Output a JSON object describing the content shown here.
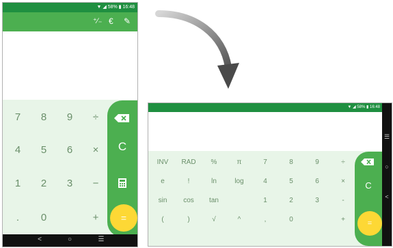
{
  "status": {
    "battery": "58%",
    "time": "16:48"
  },
  "portrait": {
    "toolbar_icons": [
      "plus-minus-icon",
      "euro-icon",
      "ruler-icon"
    ],
    "keys": [
      [
        "7",
        "8",
        "9",
        "÷"
      ],
      [
        "4",
        "5",
        "6",
        "×"
      ],
      [
        "1",
        "2",
        "3",
        "−"
      ],
      [
        ".",
        "0",
        "",
        "+"
      ]
    ],
    "side": {
      "clear": "C",
      "equals": "="
    },
    "nav": {
      "back": "<",
      "home": "○",
      "menu": "☰"
    }
  },
  "landscape": {
    "keys": [
      [
        "INV",
        "RAD",
        "%",
        "π",
        "7",
        "8",
        "9",
        "÷"
      ],
      [
        "e",
        "!",
        "ln",
        "log",
        "4",
        "5",
        "6",
        "×"
      ],
      [
        "sin",
        "cos",
        "tan",
        "",
        "1",
        "2",
        "3",
        "-"
      ],
      [
        "(",
        ")",
        "√",
        "^",
        ",",
        "0",
        "",
        "+"
      ]
    ],
    "side": {
      "clear": "C",
      "equals": "="
    },
    "nav": {
      "menu": "☰",
      "home": "○",
      "back": "<"
    }
  },
  "colors": {
    "primary_dark": "#1f8f40",
    "primary": "#4caf50",
    "keypad_bg": "#e8f5e8",
    "accent": "#fdd835"
  }
}
